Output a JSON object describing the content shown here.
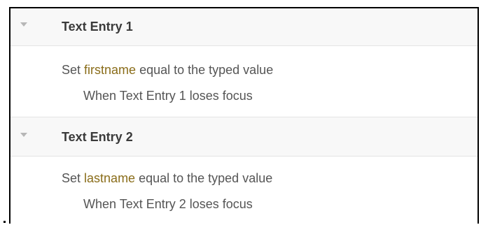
{
  "colors": {
    "variable": "#8a6d1a",
    "header_bg": "#f8f8f8",
    "text": "#555555"
  },
  "sections": [
    {
      "title": "Text Entry 1",
      "icon": "chevron-down-icon",
      "action": {
        "prefix": "Set ",
        "variable": "firstname",
        "suffix": " equal to the typed value"
      },
      "trigger": "When Text Entry 1 loses focus"
    },
    {
      "title": "Text Entry 2",
      "icon": "chevron-down-icon",
      "action": {
        "prefix": "Set ",
        "variable": "lastname",
        "suffix": " equal to the typed value"
      },
      "trigger": "When Text Entry 2 loses focus"
    }
  ]
}
